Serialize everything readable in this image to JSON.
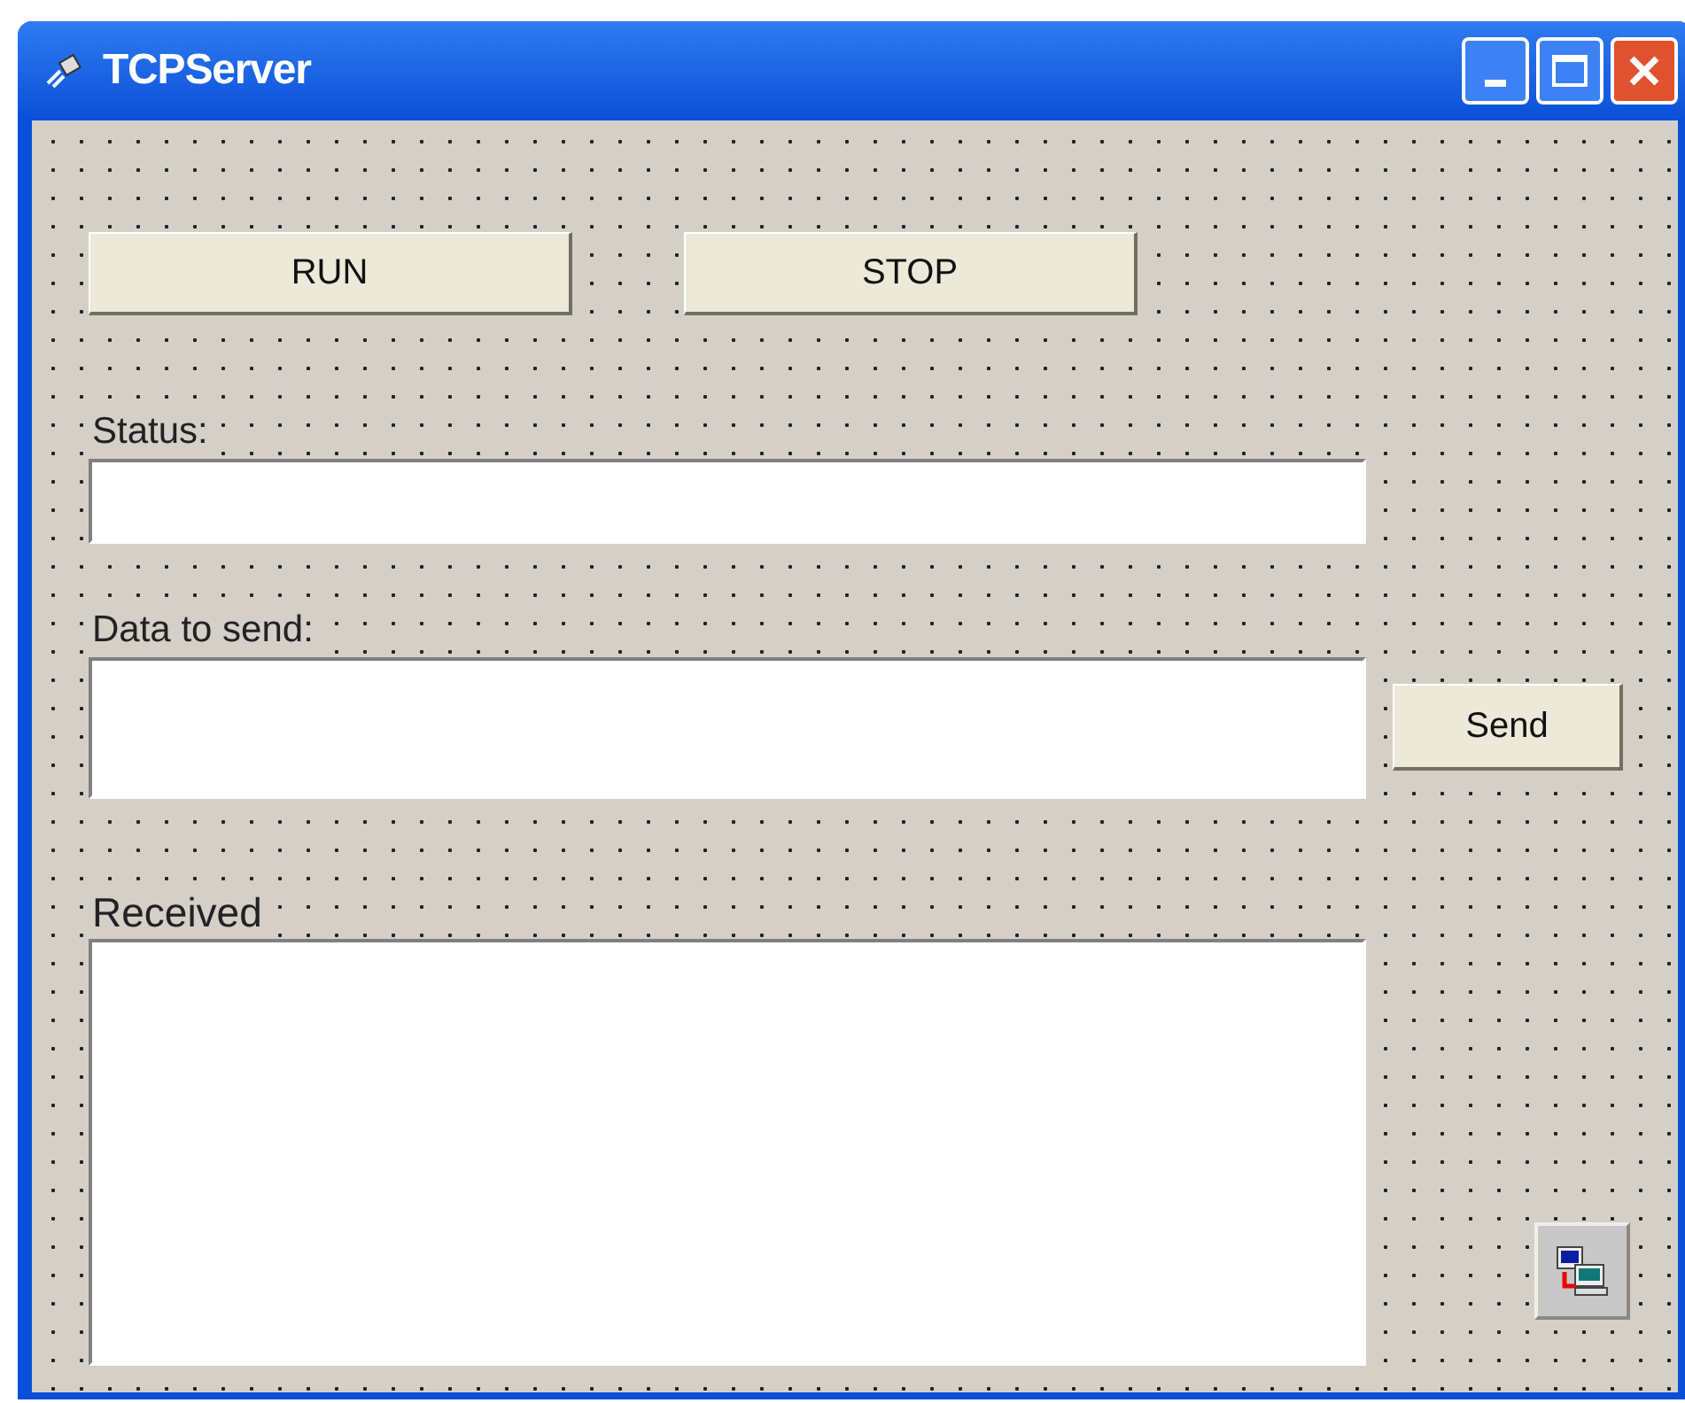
{
  "window": {
    "title": "TCPServer"
  },
  "buttons": [
    {
      "label": "RUN"
    },
    {
      "label": "STOP"
    },
    {
      "label": "Send"
    }
  ],
  "labels": [
    "Status:",
    "Data to send:",
    "Received"
  ]
}
